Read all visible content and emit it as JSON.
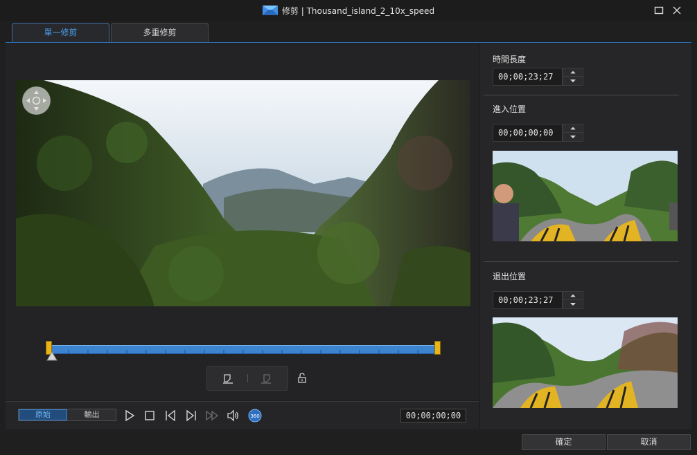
{
  "window": {
    "title": "修剪 | Thousand_island_2_10x_speed"
  },
  "tabs": [
    {
      "label": "單一修剪",
      "active": true
    },
    {
      "label": "多重修剪",
      "active": false
    }
  ],
  "preview": {
    "toggle_original": "原始",
    "toggle_output": "輸出",
    "timecode": "00;00;00;00",
    "badge_360": "360"
  },
  "duration": {
    "label": "時間長度",
    "value": "00;00;23;27"
  },
  "mark_in": {
    "label": "進入位置",
    "value": "00;00;00;00"
  },
  "mark_out": {
    "label": "退出位置",
    "value": "00;00;23;27"
  },
  "footer": {
    "ok_label": "確定",
    "cancel_label": "取消"
  },
  "colors": {
    "accent": "#3d84d0",
    "marker": "#e8b417",
    "tab_active_text": "#4a9be6"
  }
}
